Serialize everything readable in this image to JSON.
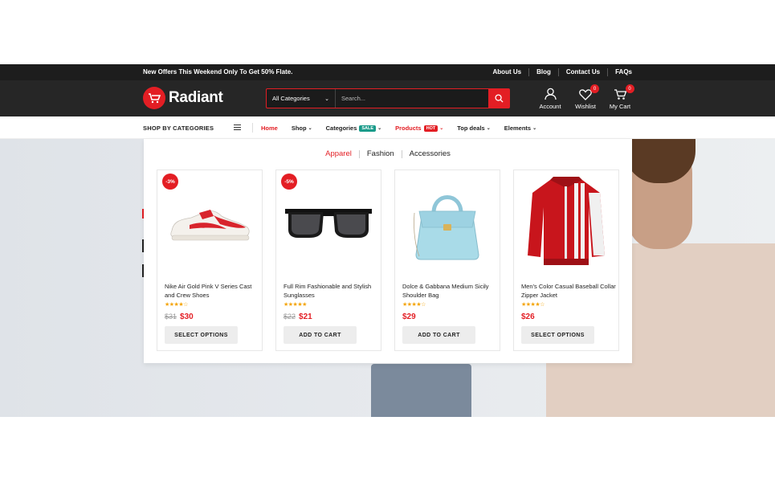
{
  "topbar": {
    "offer": "New Offers This Weekend Only To Get 50% Flate.",
    "links": [
      "About Us",
      "Blog",
      "Contact Us",
      "FAQs"
    ]
  },
  "header": {
    "logo": "Radiant",
    "search": {
      "category": "All Categories",
      "placeholder": "Search..."
    },
    "account_label": "Account",
    "wishlist_label": "Wishlist",
    "wishlist_count": "0",
    "cart_label": "My Cart",
    "cart_count": "0",
    "icons": {
      "search": "search-icon",
      "account": "user-icon",
      "wishlist": "heart-icon",
      "cart": "cart-icon"
    }
  },
  "nav": {
    "shop_by": "SHOP BY CATEGORIES",
    "items": [
      {
        "label": "Home"
      },
      {
        "label": "Shop"
      },
      {
        "label": "Categories",
        "badge": "SALE"
      },
      {
        "label": "Products",
        "badge": "HOT"
      },
      {
        "label": "Top deals"
      },
      {
        "label": "Elements"
      }
    ]
  },
  "mega": {
    "tabs": [
      "Apparel",
      "Fashion",
      "Accessories"
    ],
    "products": [
      {
        "discount": "-3%",
        "title": "Nike Air Gold Pink V Series Cast and Crew Shoes",
        "stars": "★★★★☆",
        "old_price": "$31",
        "price": "$30",
        "cta": "SELECT OPTIONS"
      },
      {
        "discount": "-5%",
        "title": "Full Rim Fashionable and Stylish Sunglasses",
        "stars": "★★★★★",
        "old_price": "$22",
        "price": "$21",
        "cta": "ADD TO CART"
      },
      {
        "title": "Dolce & Gabbana Medium Sicily Shoulder Bag",
        "stars": "★★★★☆",
        "price": "$29",
        "cta": "ADD TO CART"
      },
      {
        "title": "Men's Color Casual Baseball Collar Zipper Jacket",
        "stars": "★★★★☆",
        "price": "$26",
        "cta": "SELECT OPTIONS"
      }
    ]
  },
  "colors": {
    "accent": "#e31e24",
    "dark": "#262626",
    "sale": "#1a9b8a"
  }
}
